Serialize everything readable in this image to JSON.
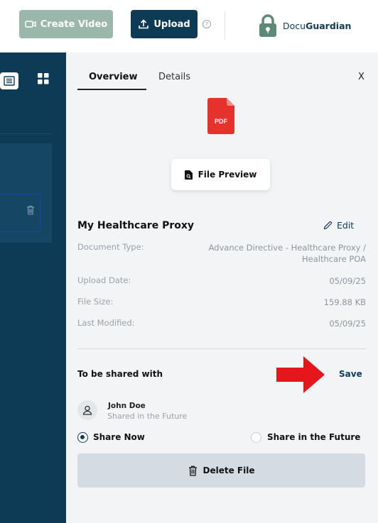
{
  "header": {
    "create_video_label": "Create Video",
    "upload_label": "Upload",
    "help_glyph": "?",
    "logo_text_light": "Docu",
    "logo_text_bold": "Guardian",
    "colors": {
      "create_video_bg": "#9bb7ac",
      "upload_bg": "#0d3b56",
      "brand": "#0d3b56"
    }
  },
  "sidebar": {
    "view_icons": [
      "list-view-icon",
      "grid-view-icon"
    ],
    "background": "#0d3b56"
  },
  "panel": {
    "tabs": [
      {
        "label": "Overview",
        "active": true
      },
      {
        "label": "Details",
        "active": false
      }
    ],
    "close_label": "X",
    "pdf_badge": "PDF",
    "file_preview_label": "File Preview",
    "doc_title": "My Healthcare Proxy",
    "edit_label": "Edit",
    "details": {
      "type_label": "Document Type:",
      "type_value_line1": "Advance Directive - Healthcare Proxy /",
      "type_value_line2": "Healthcare POA",
      "upload_label": "Upload Date:",
      "upload_value": "05/09/25",
      "size_label": "File Size:",
      "size_value": "159.88 KB",
      "modified_label": "Last Modified:",
      "modified_value": "05/09/25"
    },
    "share": {
      "title": "To be shared with",
      "save_label": "Save",
      "user_name": "John Doe",
      "user_status": "Shared in the Future",
      "option_now": "Share Now",
      "option_future": "Share in the Future",
      "selected": "Share Now"
    },
    "delete_label": "Delete File",
    "colors": {
      "arrow": "#e5171d",
      "pdf": "#e5322d"
    }
  }
}
